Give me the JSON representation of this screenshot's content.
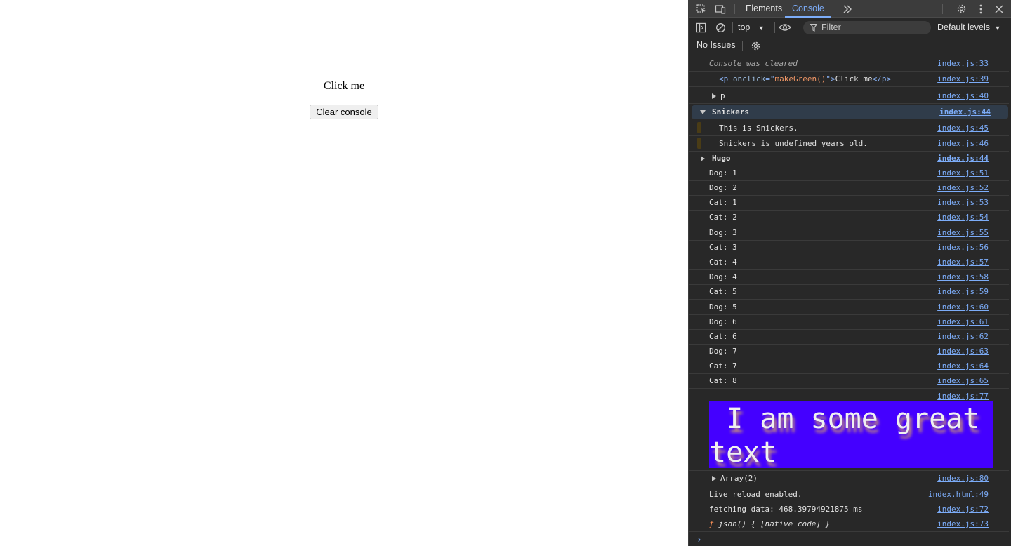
{
  "page": {
    "click_text": "Click me",
    "clear_button": "Clear console"
  },
  "devtools": {
    "tabs": [
      {
        "label": "Elements",
        "active": false
      },
      {
        "label": "Console",
        "active": true
      }
    ],
    "context": "top",
    "filter_placeholder": "Filter",
    "levels": "Default levels",
    "issues": "No Issues",
    "prompt": "›",
    "styled_text": "I am some great text",
    "styled_source": "index.js:77"
  },
  "console": [
    {
      "type": "cleared",
      "text": "Console was cleared",
      "src": "index.js:33"
    },
    {
      "type": "html",
      "tag_open": "<p ",
      "attr": "onclick",
      "eq": "=\"",
      "value": "makeGreen()",
      "close": "\">",
      "content": "Click me",
      "tag_close": "</p>",
      "src": "index.js:39"
    },
    {
      "type": "collapsed",
      "text": "p",
      "src": "index.js:40"
    },
    {
      "type": "group-open",
      "text": "Snickers",
      "src": "index.js:44"
    },
    {
      "type": "group-child",
      "text": "This is Snickers.",
      "src": "index.js:45"
    },
    {
      "type": "group-child",
      "text": "Snickers is undefined years old.",
      "src": "index.js:46"
    },
    {
      "type": "group-closed",
      "text": "Hugo",
      "src": "index.js:44"
    },
    {
      "type": "log",
      "text": "Dog: 1",
      "src": "index.js:51"
    },
    {
      "type": "log",
      "text": "Dog: 2",
      "src": "index.js:52"
    },
    {
      "type": "log",
      "text": "Cat: 1",
      "src": "index.js:53"
    },
    {
      "type": "log",
      "text": "Cat: 2",
      "src": "index.js:54"
    },
    {
      "type": "log",
      "text": "Dog: 3",
      "src": "index.js:55"
    },
    {
      "type": "log",
      "text": "Cat: 3",
      "src": "index.js:56"
    },
    {
      "type": "log",
      "text": "Cat: 4",
      "src": "index.js:57"
    },
    {
      "type": "log",
      "text": "Dog: 4",
      "src": "index.js:58"
    },
    {
      "type": "log",
      "text": "Cat: 5",
      "src": "index.js:59"
    },
    {
      "type": "log",
      "text": "Dog: 5",
      "src": "index.js:60"
    },
    {
      "type": "log",
      "text": "Dog: 6",
      "src": "index.js:61"
    },
    {
      "type": "log",
      "text": "Cat: 6",
      "src": "index.js:62"
    },
    {
      "type": "log",
      "text": "Dog: 7",
      "src": "index.js:63"
    },
    {
      "type": "log",
      "text": "Cat: 7",
      "src": "index.js:64"
    },
    {
      "type": "log",
      "text": "Cat: 8",
      "src": "index.js:65"
    },
    {
      "type": "styled",
      "text": "",
      "src": "index.js:77"
    },
    {
      "type": "collapsed-array",
      "text": "Array(2)",
      "src": "index.js:80"
    },
    {
      "type": "log",
      "text": "Live reload enabled.",
      "src": "index.html:49"
    },
    {
      "type": "log",
      "text": "fetching data: 468.39794921875 ms",
      "src": "index.js:72"
    },
    {
      "type": "fn",
      "f": "ƒ",
      "text": "json() { [native code] }",
      "src": "index.js:73"
    }
  ],
  "colors": {
    "devtools_bg": "#282828",
    "link": "#7cacf8",
    "styled_bg": "#4400ff"
  }
}
